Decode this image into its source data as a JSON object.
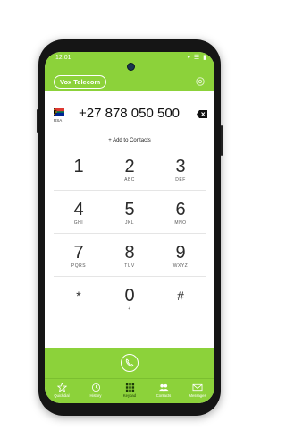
{
  "status": {
    "time": "12:01",
    "icons": "▾ ☰ ▮"
  },
  "header": {
    "brand": "Vox Telecom"
  },
  "dialer": {
    "country_code": "RSA",
    "number": "+27 878 050 500",
    "add_to_contacts": "+ Add to Contacts"
  },
  "keypad": {
    "rows": [
      [
        {
          "digit": "1",
          "letters": ""
        },
        {
          "digit": "2",
          "letters": "ABC"
        },
        {
          "digit": "3",
          "letters": "DEF"
        }
      ],
      [
        {
          "digit": "4",
          "letters": "GHI"
        },
        {
          "digit": "5",
          "letters": "JKL"
        },
        {
          "digit": "6",
          "letters": "MNO"
        }
      ],
      [
        {
          "digit": "7",
          "letters": "PQRS"
        },
        {
          "digit": "8",
          "letters": "TUV"
        },
        {
          "digit": "9",
          "letters": "WXYZ"
        }
      ],
      [
        {
          "digit": "*",
          "letters": ""
        },
        {
          "digit": "0",
          "letters": "+"
        },
        {
          "digit": "#",
          "letters": ""
        }
      ]
    ]
  },
  "tabs": [
    {
      "label": "Quickdial",
      "icon": "star-icon"
    },
    {
      "label": "History",
      "icon": "clock-icon"
    },
    {
      "label": "Keypad",
      "icon": "keypad-icon"
    },
    {
      "label": "Contacts",
      "icon": "contacts-icon"
    },
    {
      "label": "Messages",
      "icon": "envelope-icon"
    }
  ],
  "colors": {
    "accent": "#8cd23a",
    "active_tab": "#1c3b07"
  }
}
